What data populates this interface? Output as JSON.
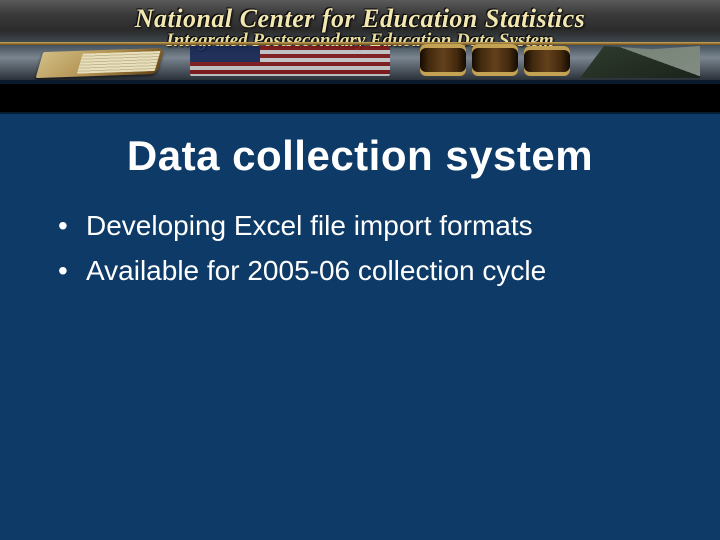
{
  "banner": {
    "line1": "National Center for Education Statistics",
    "line2": "Integrated Postsecondary Education Data System"
  },
  "title": "Data collection system",
  "bullets": [
    "Developing Excel file import formats",
    "Available for 2005-06 collection cycle"
  ]
}
